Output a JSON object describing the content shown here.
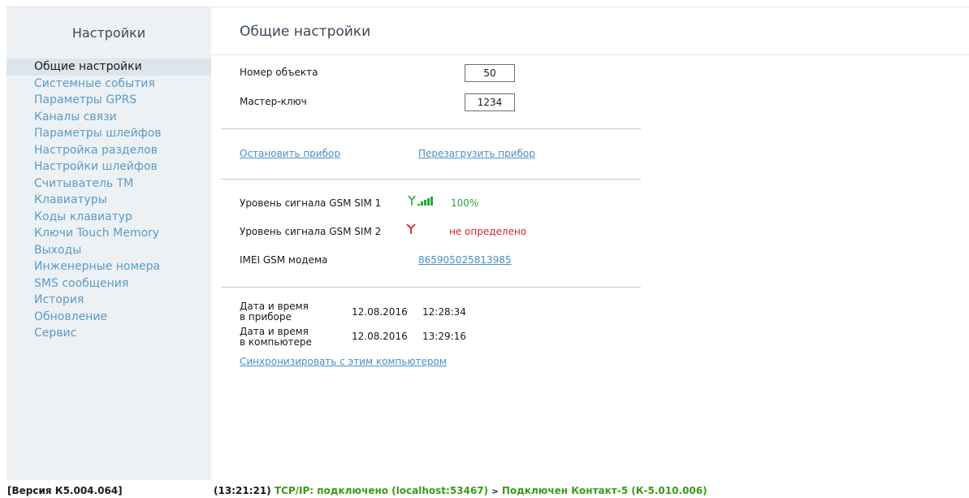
{
  "sidebar": {
    "title": "Настройки",
    "items": [
      {
        "label": "Общие настройки",
        "active": true
      },
      {
        "label": "Системные события"
      },
      {
        "label": "Параметры GPRS"
      },
      {
        "label": "Каналы связи"
      },
      {
        "label": "Параметры шлейфов"
      },
      {
        "label": "Настройка разделов"
      },
      {
        "label": "Настройки шлейфов"
      },
      {
        "label": "Считыватель ТМ"
      },
      {
        "label": "Клавиатуры"
      },
      {
        "label": "Коды клавиатур"
      },
      {
        "label": "Ключи Touch Memory"
      },
      {
        "label": "Выходы"
      },
      {
        "label": "Инженерные номера"
      },
      {
        "label": "SMS сообщения"
      },
      {
        "label": "История"
      },
      {
        "label": "Обновление"
      },
      {
        "label": "Сервис"
      }
    ]
  },
  "main": {
    "title": "Общие настройки",
    "object_number": {
      "label": "Номер объекта",
      "value": "50"
    },
    "master_key": {
      "label": "Мастер-ключ",
      "value": "1234"
    },
    "actions": {
      "stop": "Остановить прибор",
      "reboot": "Перезагрузить прибор"
    },
    "gsm1": {
      "label": "Уровень сигнала GSM SIM 1",
      "value": "100%",
      "icon": "signal-full-icon"
    },
    "gsm2": {
      "label": "Уровень сигнала GSM SIM 2",
      "value": "не определено",
      "icon": "antenna-no-signal-icon"
    },
    "imei": {
      "label": "IMEI GSM модема",
      "value": "865905025813985"
    },
    "device_time": {
      "label_line1": "Дата и время",
      "label_line2": "в приборе",
      "date": "12.08.2016",
      "time": "12:28:34"
    },
    "computer_time": {
      "label_line1": "Дата и время",
      "label_line2": "в компьютере",
      "date": "12.08.2016",
      "time": "13:29:16"
    },
    "sync_link": "Синхронизировать с этим компьютером"
  },
  "colors": {
    "link": "#4a8ec3",
    "ok": "#27a53a",
    "error": "#d8262e",
    "sidebar_bg": "#edf1f4",
    "status_green": "#3a9a1a"
  },
  "statusbar": {
    "version": "[Версия К5.004.064]",
    "time": "(13:21:21)",
    "tcp": "TCP/IP: подключено (localhost:53467)",
    "arrow": ">",
    "device": "Подключен Контакт-5 (К-5.010.006)"
  }
}
